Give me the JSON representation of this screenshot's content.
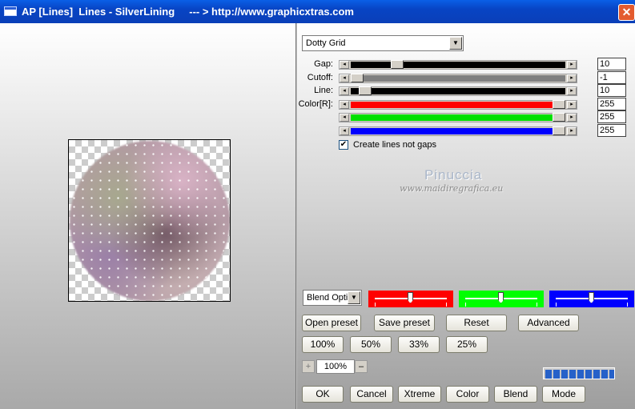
{
  "window": {
    "title": "AP [Lines]  Lines - SilverLining     --- > http://www.graphicxtras.com",
    "close_glyph": "✕"
  },
  "effect_select": {
    "value": "Dotty Grid"
  },
  "sliders": [
    {
      "label": "Gap:",
      "value": "10",
      "level": 0.2,
      "track_color": "#000000"
    },
    {
      "label": "Cutoff:",
      "value": "-1",
      "level": 0.0,
      "track_color": "#808080"
    },
    {
      "label": "Line:",
      "value": "10",
      "level": 0.04,
      "track_color": "#000000"
    },
    {
      "label": "Color[R]:",
      "value": "255",
      "level": 1.0,
      "track_color": "#ff0000"
    },
    {
      "label": "",
      "value": "255",
      "level": 1.0,
      "track_color": "#00e000"
    },
    {
      "label": "",
      "value": "255",
      "level": 1.0,
      "track_color": "#0000ff"
    }
  ],
  "checkbox": {
    "label": "Create lines not gaps",
    "checked": true,
    "mark": "✔"
  },
  "watermark": {
    "line1": "Pinuccia",
    "line2": "www.maidiregrafica.eu"
  },
  "blend_select": {
    "value": "Blend Optio"
  },
  "color_boxes": [
    {
      "color": "#ff0000",
      "level": 0.5
    },
    {
      "color": "#00ff00",
      "level": 0.5
    },
    {
      "color": "#0000ff",
      "level": 0.5
    }
  ],
  "buttons": {
    "open_preset": "Open preset",
    "save_preset": "Save preset",
    "reset": "Reset",
    "advanced": "Advanced",
    "zoom_100": "100%",
    "zoom_50": "50%",
    "zoom_33": "33%",
    "zoom_25": "25%",
    "ok": "OK",
    "cancel": "Cancel",
    "xtreme": "Xtreme",
    "color": "Color",
    "blend": "Blend",
    "mode": "Mode"
  },
  "zoom": {
    "plus": "+",
    "value": "100%",
    "minus": "–"
  },
  "progress": {
    "level": 1.0
  },
  "icons": {
    "dropdown": "▼",
    "left": "◂",
    "right": "▸"
  }
}
